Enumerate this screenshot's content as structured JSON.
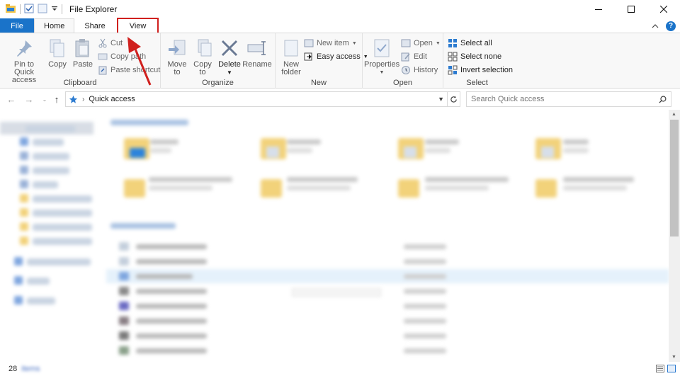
{
  "window": {
    "title": "File Explorer"
  },
  "tabs": [
    {
      "label": "File"
    },
    {
      "label": "Home"
    },
    {
      "label": "Share"
    },
    {
      "label": "View"
    }
  ],
  "ribbon": {
    "clipboard": {
      "label": "Clipboard",
      "pin": "Pin to Quick",
      "pin2": "access",
      "copy": "Copy",
      "paste": "Paste",
      "cut": "Cut",
      "copy_path": "Copy path",
      "paste_shortcut": "Paste shortcut"
    },
    "organize": {
      "label": "Organize",
      "move": "Move",
      "move2": "to",
      "copy": "Copy",
      "copy2": "to",
      "delete": "Delete",
      "rename": "Rename"
    },
    "new": {
      "label": "New",
      "new_folder": "New",
      "new_folder2": "folder",
      "new_item": "New item",
      "easy_access": "Easy access"
    },
    "open": {
      "label": "Open",
      "properties": "Properties",
      "open": "Open",
      "edit": "Edit",
      "history": "History"
    },
    "select": {
      "label": "Select",
      "select_all": "Select all",
      "select_none": "Select none",
      "invert": "Invert selection"
    }
  },
  "address": {
    "path": "Quick access",
    "search_placeholder": "Search Quick access"
  },
  "status": {
    "count": "28",
    "items": "items"
  },
  "colors": {
    "accent": "#1a73c9",
    "annotation": "#d0201e"
  }
}
